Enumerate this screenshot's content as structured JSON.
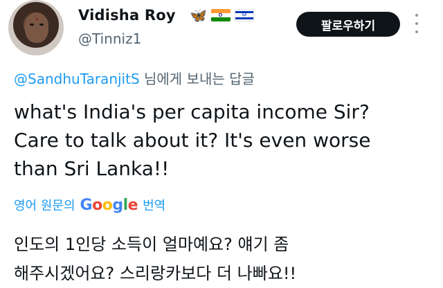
{
  "user": {
    "display_name": "Vidisha Roy",
    "handle": "@Tinniz1",
    "badges": [
      "butterfly-icon",
      "india-flag-icon",
      "israel-flag-icon"
    ]
  },
  "follow_button_label": "팔로우하기",
  "reply": {
    "mention": "@SandhuTaranjitS",
    "suffix": " 님에게 보내는 답글"
  },
  "tweet": {
    "lines": [
      "what's India's per capita income Sir?",
      "Care to talk about it? It's even worse",
      "than Sri Lanka!!"
    ]
  },
  "translation": {
    "prefix": "영어 원문의",
    "brand": [
      "G",
      "o",
      "o",
      "g",
      "l",
      "e"
    ],
    "suffix": "번역",
    "lines": [
      "인도의 1인당 소득이 얼마예요? 얘기 좀",
      "해주시겠어요? 스리랑카보다 더 나빠요!!"
    ]
  },
  "colors": {
    "link": "#1d9bf0",
    "secondary_text": "#536471",
    "button_bg": "#0f1419"
  }
}
